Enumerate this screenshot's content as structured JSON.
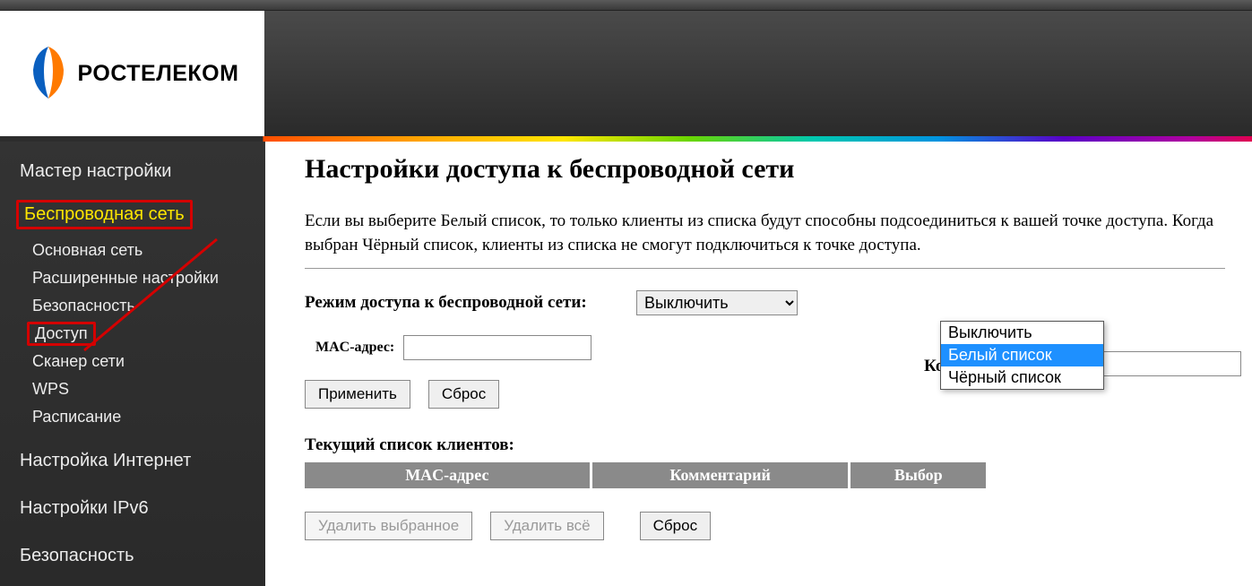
{
  "brand": "РОСТЕЛЕКОМ",
  "sidebar": {
    "items": [
      {
        "label": "Мастер настройки",
        "type": "top"
      },
      {
        "label": "Беспроводная сеть",
        "type": "top-highlight"
      },
      {
        "label": "Основная сеть",
        "type": "sub"
      },
      {
        "label": "Расширенные настройки",
        "type": "sub"
      },
      {
        "label": "Безопасность",
        "type": "sub"
      },
      {
        "label": "Доступ",
        "type": "sub-highlight"
      },
      {
        "label": "Сканер сети",
        "type": "sub"
      },
      {
        "label": "WPS",
        "type": "sub"
      },
      {
        "label": "Расписание",
        "type": "sub"
      },
      {
        "label": "Настройка Интернет",
        "type": "top"
      },
      {
        "label": "Настройки IPv6",
        "type": "top"
      },
      {
        "label": "Безопасность",
        "type": "top"
      }
    ]
  },
  "page": {
    "title": "Настройки доступа к беспроводной сети",
    "description": "Если вы выберите Белый список, то только клиенты из списка будут способны подсоединиться к вашей точке доступа. Когда выбран Чёрный список, клиенты из списка не смогут подключиться к точке доступа.",
    "mode_label": "Режим доступа к беспроводной сети:",
    "mode_value": "Выключить",
    "mode_options": [
      "Выключить",
      "Белый список",
      "Чёрный список"
    ],
    "mac_label": "MAC-адрес:",
    "comment_label_partial": "Ко",
    "apply": "Применить",
    "reset": "Сброс",
    "clients_label": "Текущий список клиентов:",
    "table_headers": [
      "MAC-адрес",
      "Комментарий",
      "Выбор"
    ],
    "delete_selected": "Удалить выбранное",
    "delete_all": "Удалить всё",
    "reset2": "Сброс"
  }
}
